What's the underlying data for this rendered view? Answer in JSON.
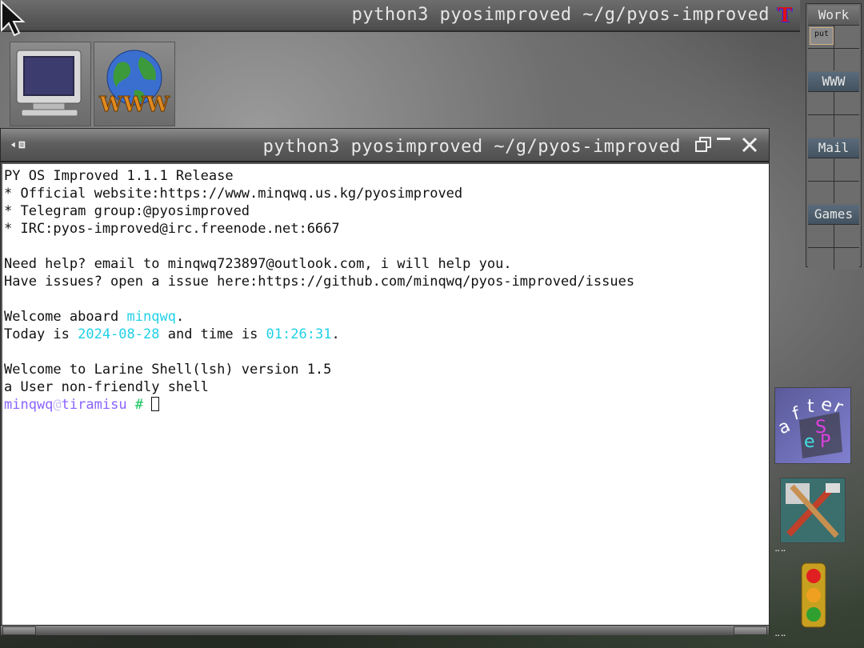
{
  "top_bar": {
    "title": "python3 pyosimproved ~/g/pyos-improved",
    "app_icon_letter": "T"
  },
  "desktop_icons": [
    {
      "name": "monitor",
      "label": ""
    },
    {
      "name": "www",
      "label": "WWW"
    }
  ],
  "pager": {
    "desks": [
      {
        "label": "Work",
        "active": true,
        "window_label": "put"
      },
      {
        "label": "WWW",
        "active": false
      },
      {
        "label": "Mail",
        "active": false
      },
      {
        "label": "Games",
        "active": false
      }
    ]
  },
  "terminal": {
    "title": "python3 pyosimproved ~/g/pyos-improved",
    "lines": [
      "PY OS Improved 1.1.1 Release",
      "* Official website:https://www.minqwq.us.kg/pyosimproved",
      "* Telegram group:@pyosimproved",
      "* IRC:pyos-improved@irc.freenode.net:6667",
      "",
      "Need help? email to minqwq723897@outlook.com, i will help you.",
      "Have issues? open a issue here:https://github.com/minqwq/pyos-improved/issues",
      ""
    ],
    "welcome": {
      "prefix": "Welcome aboard ",
      "username": "minqwq",
      "suffix": "."
    },
    "today": {
      "prefix": "Today is ",
      "date": "2024-08-28",
      "middle": " and time is ",
      "time": "01:26:31",
      "suffix": "."
    },
    "shell_lines": [
      "Welcome to Larine Shell(lsh) version 1.5",
      "a User non-friendly shell"
    ],
    "prompt": {
      "user": "minqwq",
      "at": "@",
      "host": "tiramisu",
      "symbol": " # "
    }
  },
  "colors": {
    "cyan": "#20d0e8",
    "purple": "#8b62ff",
    "green": "#13c45a"
  }
}
